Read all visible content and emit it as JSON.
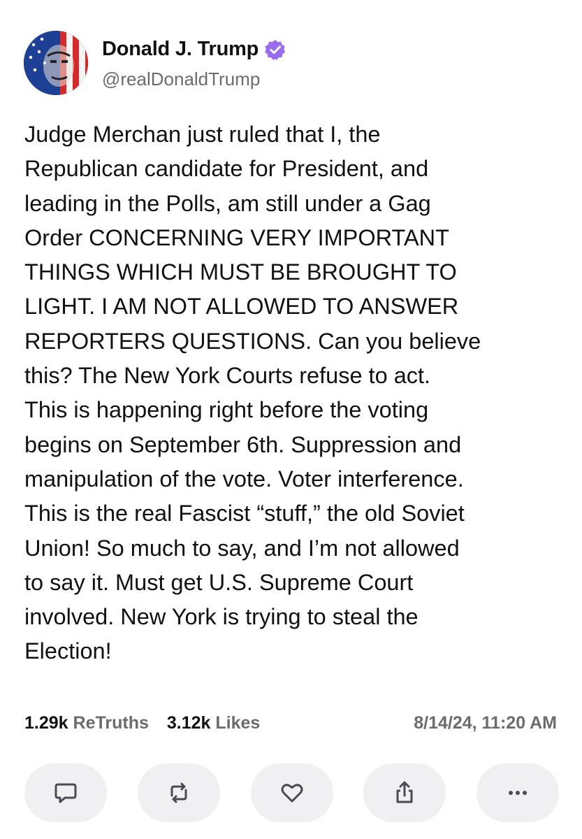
{
  "author": {
    "display_name": "Donald J. Trump",
    "handle": "@realDonaldTrump",
    "verified_color": "#9a6df0"
  },
  "post": {
    "text": "Judge Merchan just ruled that I, the\nRepublican candidate for President, and\nleading in the Polls, am still under a Gag\nOrder CONCERNING VERY IMPORTANT\nTHINGS WHICH MUST BE BROUGHT TO\nLIGHT. I AM NOT ALLOWED TO ANSWER\nREPORTERS QUESTIONS. Can you believe\nthis? The New York Courts refuse to act.\nThis is happening right before the voting\nbegins on September 6th. Suppression and\nmanipulation of the vote. Voter interference.\nThis is the real Fascist “stuff,” the old Soviet\nUnion! So much to say, and I’m not allowed\nto say it. Must get U.S. Supreme Court\ninvolved. New York is trying to steal the\nElection!"
  },
  "stats": {
    "retruths_count": "1.29k",
    "retruths_label": "ReTruths",
    "likes_count": "3.12k",
    "likes_label": "Likes",
    "timestamp": "8/14/24, 11:20 AM"
  },
  "actions": [
    {
      "icon": "reply-icon"
    },
    {
      "icon": "retruth-icon"
    },
    {
      "icon": "like-icon"
    },
    {
      "icon": "share-icon"
    },
    {
      "icon": "more-icon"
    }
  ],
  "colors": {
    "action_bg": "#f0f0f3",
    "icon": "#4a4a55",
    "muted": "#6b6b70"
  }
}
